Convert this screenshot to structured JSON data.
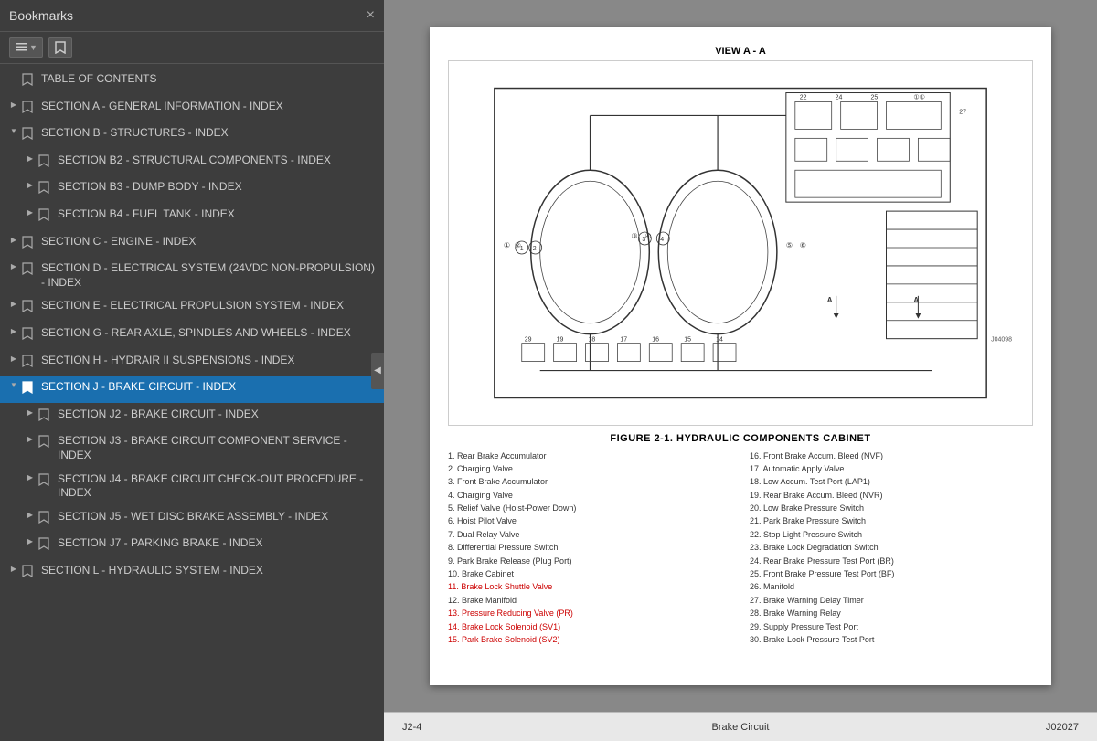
{
  "sidebar": {
    "title": "Bookmarks",
    "close_label": "×",
    "toolbar": {
      "menu_icon": "menu-icon",
      "bookmark_icon": "bookmark-icon"
    },
    "items": [
      {
        "id": "toc",
        "label": "TABLE OF CONTENTS",
        "indent": 0,
        "expand": "none",
        "selected": false
      },
      {
        "id": "sec-a",
        "label": "SECTION A - GENERAL INFORMATION - INDEX",
        "indent": 0,
        "expand": "collapsed",
        "selected": false
      },
      {
        "id": "sec-b",
        "label": "SECTION B - STRUCTURES - INDEX",
        "indent": 0,
        "expand": "expanded",
        "selected": false
      },
      {
        "id": "sec-b2",
        "label": "SECTION B2 - STRUCTURAL COMPONENTS - INDEX",
        "indent": 1,
        "expand": "collapsed",
        "selected": false
      },
      {
        "id": "sec-b3",
        "label": "SECTION B3 - DUMP BODY - INDEX",
        "indent": 1,
        "expand": "collapsed",
        "selected": false
      },
      {
        "id": "sec-b4",
        "label": "SECTION B4 - FUEL TANK - INDEX",
        "indent": 1,
        "expand": "collapsed",
        "selected": false
      },
      {
        "id": "sec-c",
        "label": "SECTION C - ENGINE - INDEX",
        "indent": 0,
        "expand": "collapsed",
        "selected": false
      },
      {
        "id": "sec-d",
        "label": "SECTION D - ELECTRICAL SYSTEM (24VDC NON-PROPULSION) - INDEX",
        "indent": 0,
        "expand": "collapsed",
        "selected": false
      },
      {
        "id": "sec-e",
        "label": "SECTION E - ELECTRICAL PROPULSION SYSTEM - INDEX",
        "indent": 0,
        "expand": "collapsed",
        "selected": false
      },
      {
        "id": "sec-g",
        "label": "SECTION G - REAR AXLE, SPINDLES AND WHEELS - INDEX",
        "indent": 0,
        "expand": "collapsed",
        "selected": false
      },
      {
        "id": "sec-h",
        "label": "SECTION H - HYDRAIR II SUSPENSIONS - INDEX",
        "indent": 0,
        "expand": "collapsed",
        "selected": false
      },
      {
        "id": "sec-j",
        "label": "SECTION J - BRAKE CIRCUIT - INDEX",
        "indent": 0,
        "expand": "expanded",
        "selected": true
      },
      {
        "id": "sec-j2",
        "label": "SECTION J2 - BRAKE CIRCUIT - INDEX",
        "indent": 1,
        "expand": "collapsed",
        "selected": false
      },
      {
        "id": "sec-j3",
        "label": "SECTION J3 - BRAKE CIRCUIT COMPONENT SERVICE - INDEX",
        "indent": 1,
        "expand": "collapsed",
        "selected": false
      },
      {
        "id": "sec-j4",
        "label": "SECTION J4 - BRAKE CIRCUIT CHECK-OUT PROCEDURE - INDEX",
        "indent": 1,
        "expand": "collapsed",
        "selected": false
      },
      {
        "id": "sec-j5",
        "label": "SECTION J5 - WET DISC BRAKE ASSEMBLY - INDEX",
        "indent": 1,
        "expand": "collapsed",
        "selected": false
      },
      {
        "id": "sec-j7",
        "label": "SECTION J7 - PARKING BRAKE - INDEX",
        "indent": 1,
        "expand": "collapsed",
        "selected": false
      },
      {
        "id": "sec-l",
        "label": "SECTION L - HYDRAULIC SYSTEM - INDEX",
        "indent": 0,
        "expand": "collapsed",
        "selected": false
      }
    ]
  },
  "document": {
    "view_label": "VIEW A - A",
    "figure_caption": "FIGURE 2-1. HYDRAULIC COMPONENTS CABINET",
    "legend_left": [
      "1.  Rear Brake Accumulator",
      "2.  Charging Valve",
      "3.  Front Brake Accumulator",
      "4.  Charging Valve",
      "5.  Relief Valve (Hoist-Power Down)",
      "6.  Hoist Pilot Valve",
      "7.  Dual Relay Valve",
      "8.  Differential Pressure Switch",
      "9.  Park Brake Release (Plug Port)",
      "10. Brake Cabinet",
      "11. Brake Lock Shuttle Valve",
      "12. Brake Manifold",
      "13. Pressure Reducing Valve (PR)",
      "14. Brake Lock Solenoid (SV1)",
      "15. Park Brake Solenoid (SV2)"
    ],
    "legend_right": [
      "16. Front Brake Accum. Bleed (NVF)",
      "17. Automatic Apply Valve",
      "18. Low Accum. Test Port (LAP1)",
      "19. Rear Brake Accum. Bleed (NVR)",
      "20. Low Brake Pressure Switch",
      "21. Park Brake Pressure Switch",
      "22. Stop Light Pressure Switch",
      "23. Brake Lock Degradation Switch",
      "24. Rear Brake Pressure Test Port (BR)",
      "25. Front Brake Pressure Test Port (BF)",
      "26. Manifold",
      "27. Brake Warning Delay Timer",
      "28. Brake Warning Relay",
      "29. Supply Pressure Test Port",
      "30. Brake Lock Pressure Test Port"
    ],
    "legend_red_items": [
      11,
      13,
      14,
      15
    ],
    "footer_left": "J2-4",
    "footer_center": "Brake Circuit",
    "footer_right": "J02027"
  }
}
